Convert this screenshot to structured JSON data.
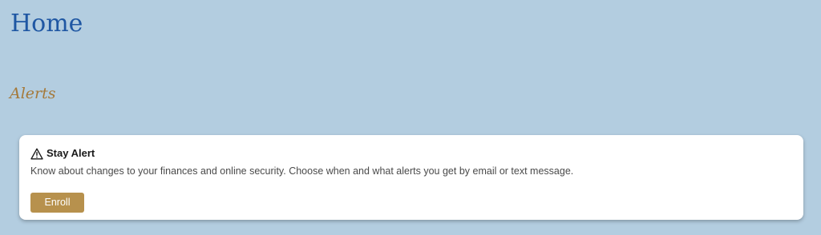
{
  "page": {
    "title": "Home",
    "background_color": "#b3cde0"
  },
  "alerts_section": {
    "title": "Alerts",
    "card": {
      "icon": "warning-triangle-icon",
      "title": "Stay Alert",
      "description": "Know about changes to your finances and online security. Choose when and what alerts you get by email or text message.",
      "enroll_label": "Enroll",
      "enroll_button_color": "#b7914d"
    }
  },
  "colors": {
    "title": "#1f57a3",
    "section_title": "#a5793a"
  }
}
